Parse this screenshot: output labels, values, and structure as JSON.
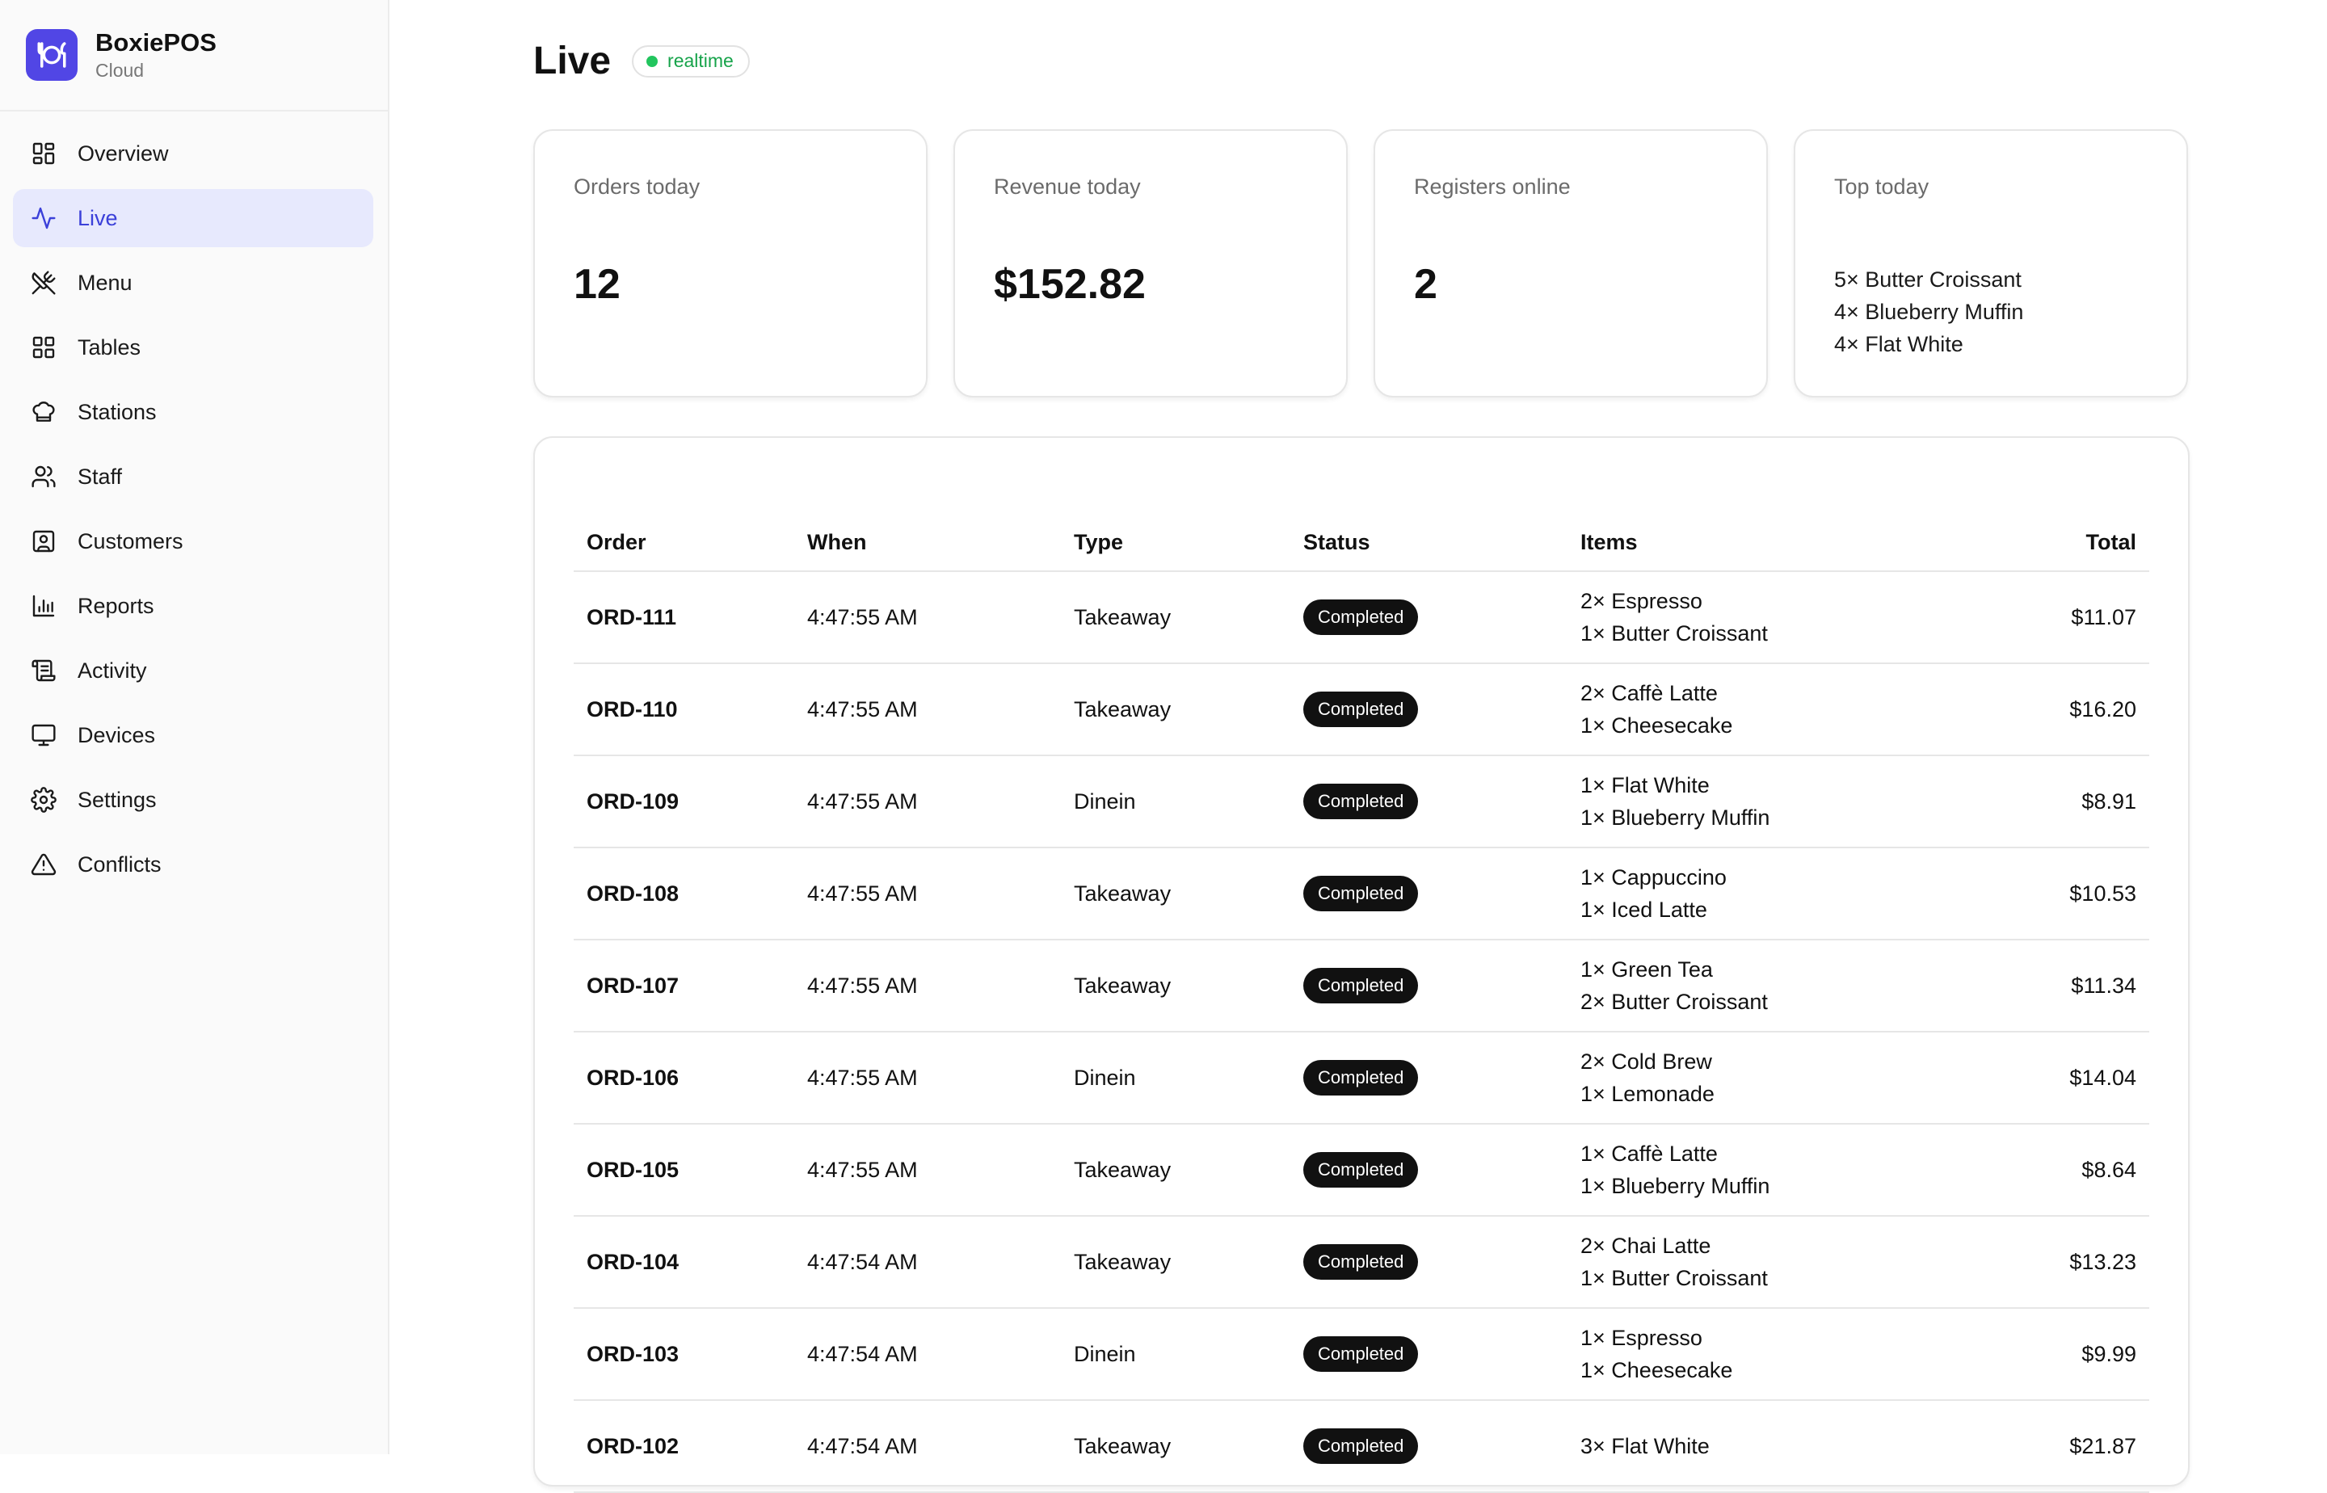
{
  "brand": {
    "name": "BoxiePOS",
    "subtitle": "Cloud",
    "accent": "#5146e5"
  },
  "nav": [
    {
      "label": "Overview",
      "icon": "grid-icon",
      "active": false
    },
    {
      "label": "Live",
      "icon": "activity-pulse-icon",
      "active": true
    },
    {
      "label": "Menu",
      "icon": "utensils-crossed-icon",
      "active": false
    },
    {
      "label": "Tables",
      "icon": "grid-icon",
      "active": false
    },
    {
      "label": "Stations",
      "icon": "chef-hat-icon",
      "active": false
    },
    {
      "label": "Staff",
      "icon": "users-icon",
      "active": false
    },
    {
      "label": "Customers",
      "icon": "contact-icon",
      "active": false
    },
    {
      "label": "Reports",
      "icon": "bar-chart-icon",
      "active": false
    },
    {
      "label": "Activity",
      "icon": "scroll-icon",
      "active": false
    },
    {
      "label": "Devices",
      "icon": "monitor-icon",
      "active": false
    },
    {
      "label": "Settings",
      "icon": "gear-icon",
      "active": false
    },
    {
      "label": "Conflicts",
      "icon": "warning-triangle-icon",
      "active": false
    }
  ],
  "page": {
    "title": "Live",
    "badge": "realtime"
  },
  "stats": {
    "orders_label": "Orders today",
    "orders_value": "12",
    "revenue_label": "Revenue today",
    "revenue_value": "$152.82",
    "registers_label": "Registers online",
    "registers_value": "2",
    "top_label": "Top today",
    "top_items": [
      "5× Butter Croissant",
      "4× Blueberry Muffin",
      "4× Flat White"
    ]
  },
  "table": {
    "headers": {
      "order": "Order",
      "when": "When",
      "type": "Type",
      "status": "Status",
      "items": "Items",
      "total": "Total"
    },
    "rows": [
      {
        "order": "ORD-111",
        "when": "4:47:55 AM",
        "type": "Takeaway",
        "status": "Completed",
        "item1": "2× Espresso",
        "item2": "1× Butter Croissant",
        "total": "$11.07"
      },
      {
        "order": "ORD-110",
        "when": "4:47:55 AM",
        "type": "Takeaway",
        "status": "Completed",
        "item1": "2× Caffè Latte",
        "item2": "1× Cheesecake",
        "total": "$16.20"
      },
      {
        "order": "ORD-109",
        "when": "4:47:55 AM",
        "type": "Dinein",
        "status": "Completed",
        "item1": "1× Flat White",
        "item2": "1× Blueberry Muffin",
        "total": "$8.91"
      },
      {
        "order": "ORD-108",
        "when": "4:47:55 AM",
        "type": "Takeaway",
        "status": "Completed",
        "item1": "1× Cappuccino",
        "item2": "1× Iced Latte",
        "total": "$10.53"
      },
      {
        "order": "ORD-107",
        "when": "4:47:55 AM",
        "type": "Takeaway",
        "status": "Completed",
        "item1": "1× Green Tea",
        "item2": "2× Butter Croissant",
        "total": "$11.34"
      },
      {
        "order": "ORD-106",
        "when": "4:47:55 AM",
        "type": "Dinein",
        "status": "Completed",
        "item1": "2× Cold Brew",
        "item2": "1× Lemonade",
        "total": "$14.04"
      },
      {
        "order": "ORD-105",
        "when": "4:47:55 AM",
        "type": "Takeaway",
        "status": "Completed",
        "item1": "1× Caffè Latte",
        "item2": "1× Blueberry Muffin",
        "total": "$8.64"
      },
      {
        "order": "ORD-104",
        "when": "4:47:54 AM",
        "type": "Takeaway",
        "status": "Completed",
        "item1": "2× Chai Latte",
        "item2": "1× Butter Croissant",
        "total": "$13.23"
      },
      {
        "order": "ORD-103",
        "when": "4:47:54 AM",
        "type": "Dinein",
        "status": "Completed",
        "item1": "1× Espresso",
        "item2": "1× Cheesecake",
        "total": "$9.99"
      },
      {
        "order": "ORD-102",
        "when": "4:47:54 AM",
        "type": "Takeaway",
        "status": "Completed",
        "item1": "3× Flat White",
        "item2": "",
        "total": "$21.87"
      }
    ]
  }
}
